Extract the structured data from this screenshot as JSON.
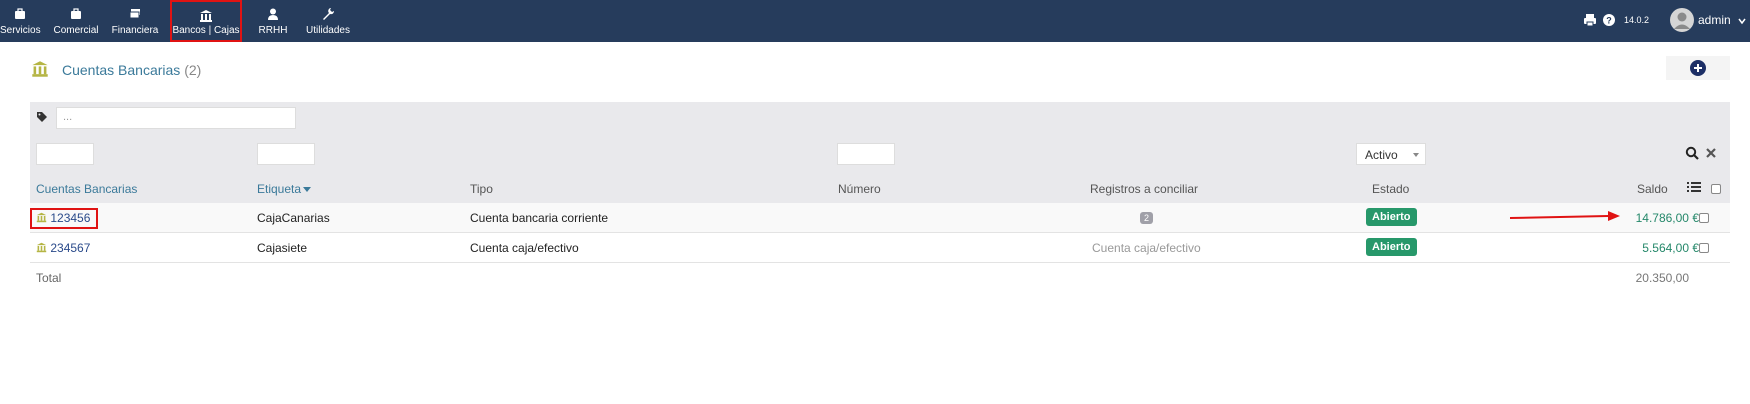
{
  "topbar": {
    "menu": [
      {
        "label": "Servicios",
        "icon": "briefcase-icon"
      },
      {
        "label": "Comercial",
        "icon": "briefcase-icon"
      },
      {
        "label": "Financiera",
        "icon": "money-icon"
      },
      {
        "label": "Bancos | Cajas",
        "icon": "bank-icon"
      },
      {
        "label": "RRHH",
        "icon": "user-icon"
      },
      {
        "label": "Utilidades",
        "icon": "wrench-icon"
      }
    ],
    "version": "14.0.2",
    "user": "admin"
  },
  "header": {
    "title": "Cuentas Bancarias",
    "count": "(2)"
  },
  "filters": {
    "tag_placeholder": "...",
    "status_value": "Activo"
  },
  "table": {
    "columns": {
      "account": "Cuentas Bancarias",
      "label": "Etiqueta",
      "type": "Tipo",
      "number": "Número",
      "reconcile": "Registros a conciliar",
      "status": "Estado",
      "balance": "Saldo"
    },
    "rows": [
      {
        "ref": "123456",
        "label": "CajaCanarias",
        "type": "Cuenta bancaria corriente",
        "number": "",
        "reconcile": "2",
        "status": "Abierto",
        "balance": "14.786,00 €"
      },
      {
        "ref": "234567",
        "label": "Cajasiete",
        "type": "Cuenta caja/efectivo",
        "number": "",
        "reconcile": "Cuenta caja/efectivo",
        "status": "Abierto",
        "balance": "5.564,00 €"
      }
    ],
    "total_label": "Total",
    "total_value": "20.350,00"
  },
  "colors": {
    "topbar": "#263c5c",
    "link": "#3b7a9a",
    "status_badge": "#27986a",
    "highlight": "#e01313"
  }
}
